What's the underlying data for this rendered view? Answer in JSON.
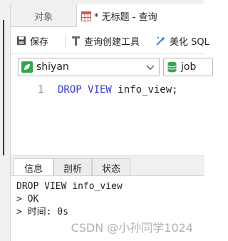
{
  "tabs": {
    "objects": "对象",
    "query": "* 无标题 - 查询"
  },
  "toolbar": {
    "save": "保存",
    "query_builder": "查询创建工具",
    "beautify": "美化 SQL",
    "icons": [
      "save-icon",
      "query-builder-icon",
      "beautify-icon"
    ]
  },
  "selectors": {
    "connection": "shiyan",
    "database": "job"
  },
  "editor": {
    "line_number": "1",
    "keyword": "DROP VIEW",
    "identifier": "info_view",
    "terminator": ";"
  },
  "result_tabs": {
    "info": "信息",
    "profile": "剖析",
    "status": "状态"
  },
  "result_lines": [
    "DROP VIEW info_view",
    "> OK",
    "> 时间: 0s"
  ],
  "watermark": "CSDN @小孙同学1024",
  "colors": {
    "keyword": "#3b3bcf",
    "connection_icon": "#2fa84f",
    "database_icon": "#2fa84f"
  }
}
